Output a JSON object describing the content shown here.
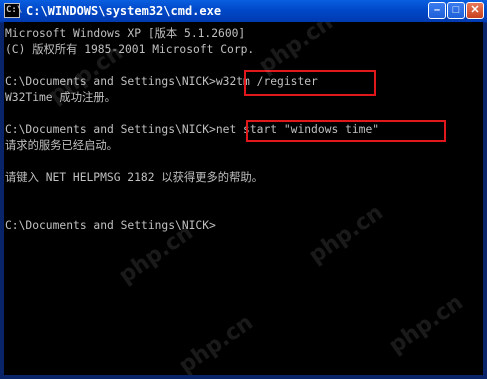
{
  "window": {
    "title": "C:\\WINDOWS\\system32\\cmd.exe",
    "icon_text": "C:\\",
    "minimize_glyph": "–",
    "maximize_glyph": "□",
    "close_glyph": "✕"
  },
  "console": {
    "lines": [
      "Microsoft Windows XP [版本 5.1.2600]",
      "(C) 版权所有 1985-2001 Microsoft Corp.",
      "",
      "C:\\Documents and Settings\\NICK>w32tm /register",
      "W32Time 成功注册。",
      "",
      "C:\\Documents and Settings\\NICK>net start \"windows time\"",
      "请求的服务已经启动。",
      "",
      "请键入 NET HELPMSG 2182 以获得更多的帮助。",
      "",
      "",
      "C:\\Documents and Settings\\NICK>"
    ]
  },
  "watermarks": [
    "php.cn",
    "php.cn",
    "php.cn",
    "php.cn",
    "php.cn",
    "php.cn"
  ],
  "colors": {
    "console_bg": "#000000",
    "console_text": "#c0c0c0",
    "titlebar": "#0048c8",
    "highlight": "#e0171b"
  }
}
